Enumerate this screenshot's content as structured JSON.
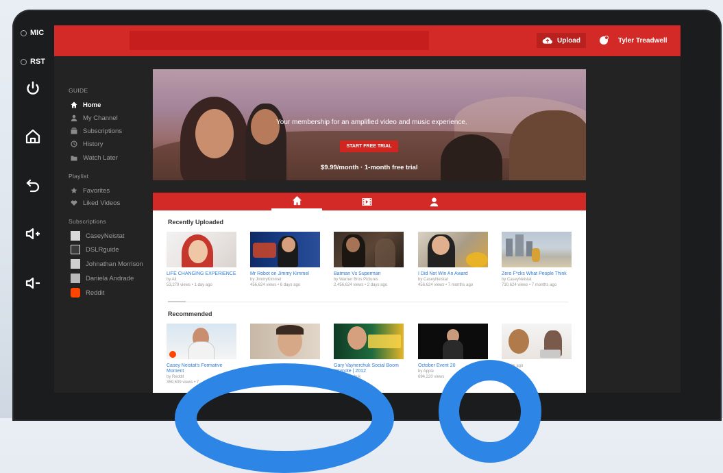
{
  "hardware": {
    "mic_label": "MIC",
    "rst_label": "RST",
    "icons": [
      "power-icon",
      "home-icon",
      "back-icon",
      "volume-up-icon",
      "volume-down-icon"
    ]
  },
  "header": {
    "upload_label": "Upload",
    "user_name": "Tyler Treadwell",
    "accent": "#d42a27"
  },
  "sidebar": {
    "guide_title": "GUIDE",
    "guide_items": [
      {
        "label": "Home",
        "icon": "home-icon"
      },
      {
        "label": "My Channel",
        "icon": "user-icon"
      },
      {
        "label": "Subscriptions",
        "icon": "subscriptions-icon"
      },
      {
        "label": "History",
        "icon": "history-icon"
      },
      {
        "label": "Watch Later",
        "icon": "watch-later-icon"
      }
    ],
    "playlist_title": "Playlist",
    "playlist_items": [
      {
        "label": "Favorites",
        "icon": "star-icon"
      },
      {
        "label": "Liked Videos",
        "icon": "heart-icon"
      }
    ],
    "subscriptions_title": "Subscriptions",
    "subscriptions": [
      {
        "label": "CaseyNeistat"
      },
      {
        "label": "DSLRguide"
      },
      {
        "label": "Johnathan Morrison"
      },
      {
        "label": "Daniela Andrade"
      },
      {
        "label": "Reddit"
      }
    ]
  },
  "banner": {
    "text": "Your membership for an amplified video and music experience.",
    "button": "START FREE TRIAL",
    "price": "$9.99/month · 1-month free trial"
  },
  "tabs": [
    {
      "icon": "home-icon"
    },
    {
      "icon": "film-icon"
    },
    {
      "icon": "user-icon"
    }
  ],
  "recently_uploaded": {
    "title": "Recently Uploaded",
    "videos": [
      {
        "title": "LIFE CHANGING EXPERIENCE",
        "channel": "by Ali",
        "meta": "53,279 views • 1 day ago"
      },
      {
        "title": "Mr Robot on Jimmy Kimmel",
        "channel": "by JimmyKimmel",
        "meta": "456,624 views • 6 days ago"
      },
      {
        "title": "Batman Vs Superman",
        "channel": "by Warner Bros Pictures",
        "meta": "2,456,624 views • 2 days ago"
      },
      {
        "title": "I Did Not Win An Award",
        "channel": "by CaseyNeistat",
        "meta": "456,624 views • 7 months ago"
      },
      {
        "title": "Zero F*cks What People Think",
        "channel": "by CaseyNeistat",
        "meta": "730,624 views • 7 months ago"
      }
    ]
  },
  "recommended": {
    "title": "Recommended",
    "videos": [
      {
        "title": "Casey Neistat's Formative Moment",
        "channel": "by Reddit",
        "meta": "359,609 views • 7"
      },
      {
        "title": "",
        "channel": "",
        "meta": ""
      },
      {
        "title": "Gary Vaynerchuk Social Boom Keynote | 2012",
        "channel": "by Vaynerchuk",
        "meta": ""
      },
      {
        "title": "October Event 20",
        "channel": "by Apple",
        "meta": "694,220 views"
      },
      {
        "title": "",
        "channel": "",
        "meta": "months ago"
      }
    ]
  }
}
